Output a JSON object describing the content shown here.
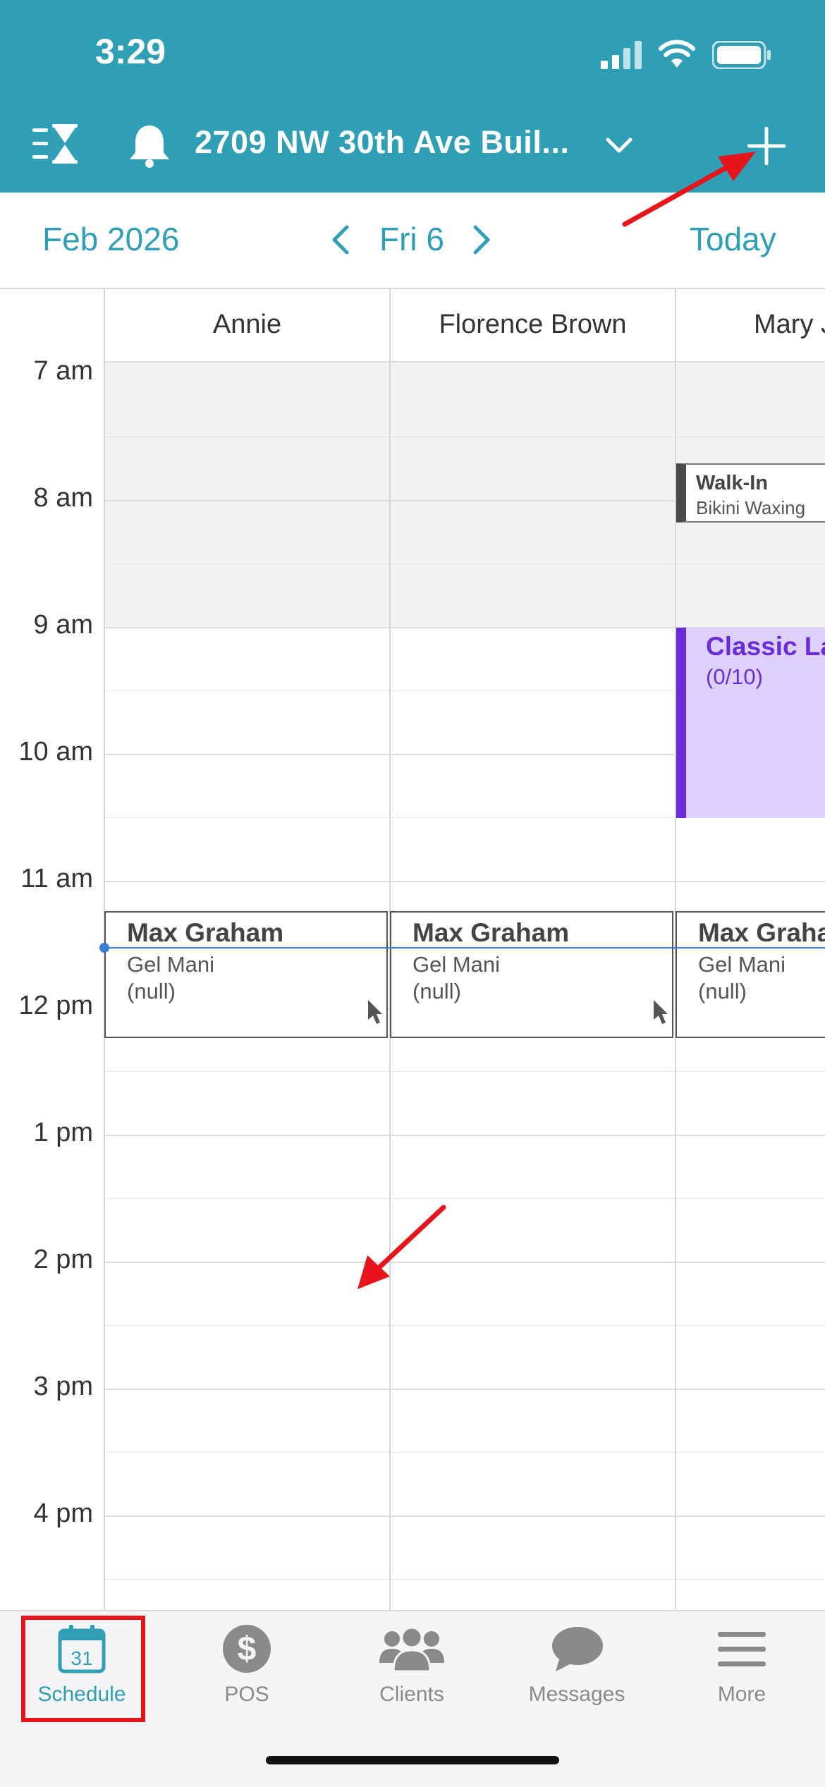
{
  "status_bar": {
    "time": "3:29"
  },
  "nav": {
    "title": "2709 NW 30th Ave Buil..."
  },
  "date_bar": {
    "month": "Feb 2026",
    "day": "Fri 6",
    "today": "Today"
  },
  "columns": [
    "Annie",
    "Florence Brown",
    "Mary J"
  ],
  "times": [
    "7 am",
    "8 am",
    "9 am",
    "10 am",
    "11 am",
    "12 pm",
    "1 pm",
    "2 pm",
    "3 pm",
    "4 pm"
  ],
  "appointments": {
    "walkin": {
      "title": "Walk-In",
      "service": "Bikini Waxing"
    },
    "classic": {
      "title": "Classic Lash",
      "count": "(0/10)"
    },
    "max1": {
      "name": "Max Graham",
      "service": "Gel Mani",
      "note": "(null)"
    },
    "max2": {
      "name": "Max Graham",
      "service": "Gel Mani",
      "note": "(null)"
    },
    "max3": {
      "name": "Max Graham",
      "service": "Gel Mani",
      "note": "(null)"
    }
  },
  "tabs": [
    {
      "label": "Schedule",
      "icon": "calendar-icon",
      "badge": "31"
    },
    {
      "label": "POS",
      "icon": "dollar-icon"
    },
    {
      "label": "Clients",
      "icon": "clients-icon"
    },
    {
      "label": "Messages",
      "icon": "messages-icon"
    },
    {
      "label": "More",
      "icon": "menu-icon"
    }
  ],
  "colors": {
    "brand": "#2f9fb6",
    "class_purple": "#6a2bd9",
    "class_fill": "#ddd0fb",
    "highlight_red": "#e8141b"
  }
}
